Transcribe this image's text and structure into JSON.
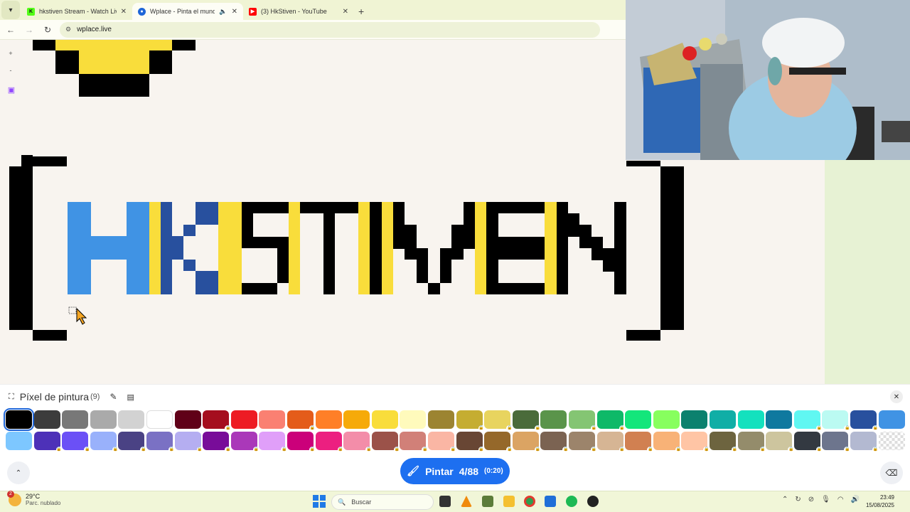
{
  "browser": {
    "tabs": [
      {
        "title": "hkstiven Stream - Watch Live o",
        "favicon": "kick-icon",
        "color": "#53fc18"
      },
      {
        "title": "Wplace - Pinta el mundo",
        "favicon": "globe-icon",
        "color": "#1f66d8",
        "active": true
      },
      {
        "title": "(3) HkStiven - YouTube",
        "favicon": "youtube-icon",
        "color": "#ff0000"
      }
    ],
    "url": "wplace.live"
  },
  "canvas": {
    "artwork_text": "HKSTIVEN",
    "zoom_in": "+",
    "zoom_out": "-"
  },
  "panel": {
    "title": "Píxel de pintura",
    "count": "(9)",
    "paint_button": {
      "label": "Pintar",
      "charges": "4/88",
      "timer": "(0:20)"
    },
    "colors_row1": [
      "#000000",
      "#3c3c3c",
      "#787878",
      "#aaaaaa",
      "#d2d2d2",
      "#ffffff",
      "#600018",
      "#a50e1e",
      "#ed1c24",
      "#fa8072",
      "#e45c1a",
      "#ff7f27",
      "#f6aa09",
      "#f9dd3b",
      "#fffabc",
      "#9c8431",
      "#c5ad31",
      "#e8d45f",
      "#4a6b3a",
      "#5a944a",
      "#84c573",
      "#0eb968",
      "#13e67b",
      "#87ff5e",
      "#0c816e",
      "#10aea6",
      "#13e1be",
      "#0f799f",
      "#60f7f2",
      "#bbfaf2",
      "#28509e",
      "#4093e4"
    ],
    "colors_row2": [
      "#7dc7ff",
      "#4d31b8",
      "#6b50f6",
      "#99b1fb",
      "#4a4284",
      "#7a71c4",
      "#b5aef1",
      "#780c99",
      "#aa38b9",
      "#e09ff9",
      "#cb007a",
      "#ec1f80",
      "#f38da9",
      "#9b5249",
      "#d18078",
      "#fab6a4",
      "#684634",
      "#95682a",
      "#dba463",
      "#7b6352",
      "#9c846b",
      "#d6b594",
      "#d18051",
      "#f8b277",
      "#ffc5a5",
      "#6d643f",
      "#948c6b",
      "#cdc59e",
      "#333941",
      "#6d758d",
      "#b3b9d1",
      "transparent"
    ],
    "selected_color": "#000000"
  },
  "taskbar": {
    "weather_temp": "29°C",
    "weather_desc": "Parc. nublado",
    "weather_badge": "2",
    "search_placeholder": "Buscar",
    "time": "23:49",
    "date": "15/08/2025"
  }
}
